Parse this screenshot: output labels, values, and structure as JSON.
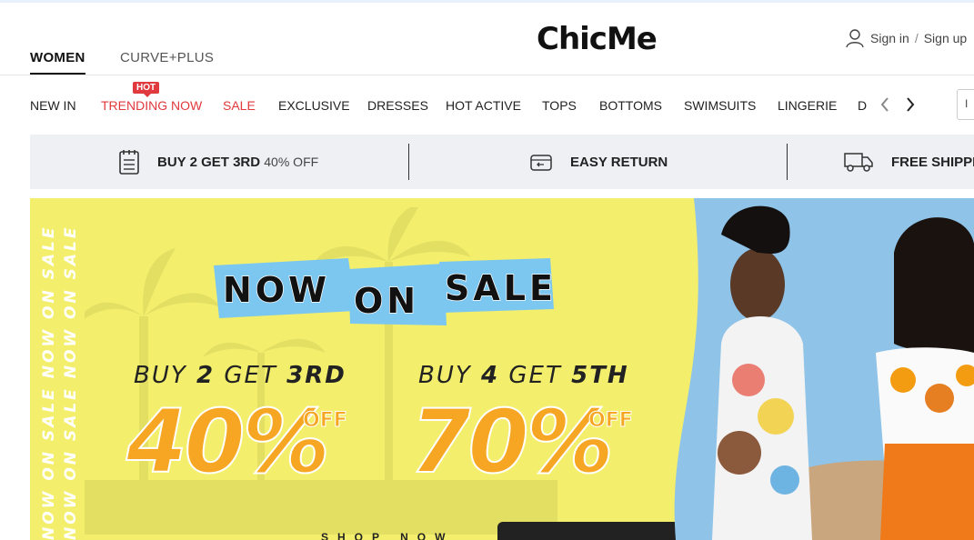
{
  "header": {
    "tabs": [
      "WOMEN",
      "CURVE+PLUS"
    ],
    "logo": "ChicMe",
    "sign_in": "Sign in",
    "separator": "/",
    "sign_up": "Sign up"
  },
  "nav": {
    "hot_badge": "HOT",
    "items": [
      "NEW IN",
      "TRENDING NOW",
      "SALE",
      "EXCLUSIVE",
      "DRESSES",
      "HOT ACTIVE",
      "TOPS",
      "BOTTOMS",
      "SWIMSUITS",
      "LINGERIE",
      "D"
    ],
    "search_glyph": "I"
  },
  "promo_bar": {
    "item1_bold": "BUY 2 GET 3RD",
    "item1_light": "40% OFF",
    "item2": "EASY RETURN",
    "item3": "FREE SHIPPI"
  },
  "banner": {
    "vertical_text": "NOW ON SALE NOW ON SALE",
    "headline_words": [
      "NOW",
      "ON",
      "SALE"
    ],
    "offer1": {
      "buy": "BUY",
      "n1": "2",
      "get": "GET",
      "n2": "3RD",
      "pct": "40%",
      "off": "OFF"
    },
    "offer2": {
      "buy": "BUY",
      "n1": "4",
      "get": "GET",
      "n2": "5TH",
      "pct": "70%",
      "off": "OFF"
    },
    "shop_text": "SHOP NOW"
  },
  "colors": {
    "accent_red": "#e0393e",
    "banner_yellow": "#f3ef6d",
    "orange": "#f6a623",
    "blue_tag": "#7cc7ef"
  }
}
